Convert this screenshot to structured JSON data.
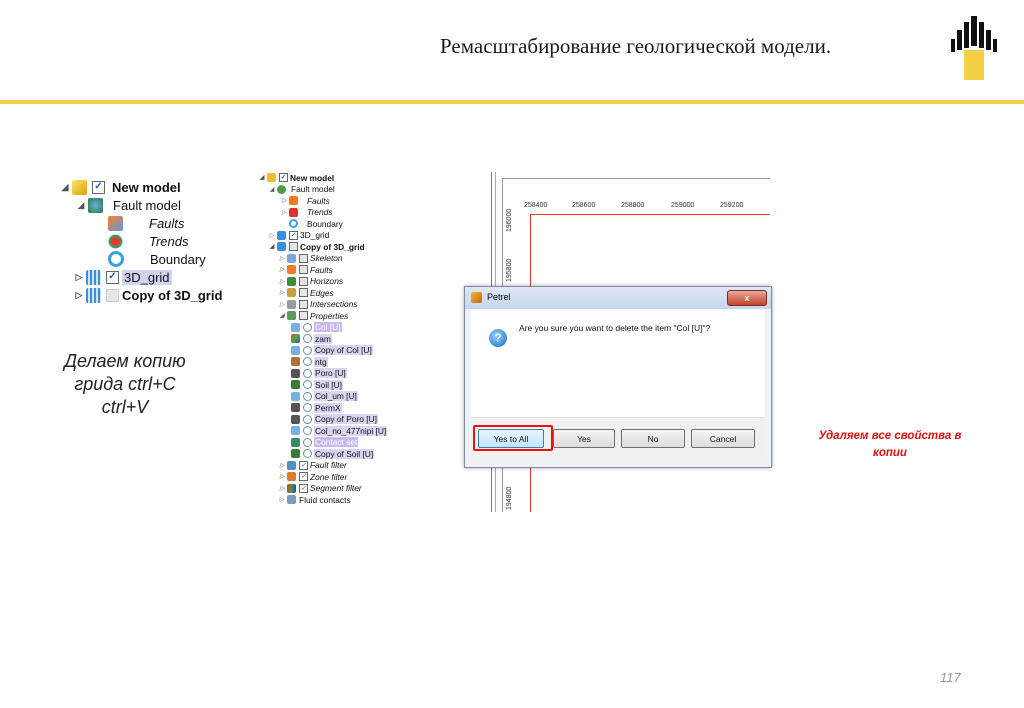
{
  "slide": {
    "title": "Ремасштабирование геологической модели.",
    "page_number": "117",
    "note_left": "Делаем копию грида ctrl+C ctrl+V",
    "note_right": "Удаляем все свойства в копии",
    "accent_color": "#f3cf45",
    "logo_icon": "rosneft-logo-icon"
  },
  "tree_large": {
    "items": [
      {
        "label": "New model"
      },
      {
        "label": "Fault model"
      },
      {
        "label": "Faults"
      },
      {
        "label": "Trends"
      },
      {
        "label": "Boundary"
      },
      {
        "label": "3D_grid"
      },
      {
        "label": "Copy of 3D_grid"
      }
    ]
  },
  "tree_small": {
    "items": [
      {
        "label": "New model"
      },
      {
        "label": "Fault model"
      },
      {
        "label": "Faults"
      },
      {
        "label": "Trends"
      },
      {
        "label": "Boundary"
      },
      {
        "label": "3D_grid"
      },
      {
        "label": "Copy of 3D_grid"
      },
      {
        "label": "Skeleton"
      },
      {
        "label": "Faults"
      },
      {
        "label": "Horizons"
      },
      {
        "label": "Edges"
      },
      {
        "label": "Intersections"
      },
      {
        "label": "Properties"
      },
      {
        "label": "Col [U]"
      },
      {
        "label": "zam"
      },
      {
        "label": "Copy of Col [U]"
      },
      {
        "label": "ntg"
      },
      {
        "label": "Poro [U]"
      },
      {
        "label": "Soil [U]"
      },
      {
        "label": "Col_um [U]"
      },
      {
        "label": "PermX"
      },
      {
        "label": "Copy of Poro [U]"
      },
      {
        "label": "Col_no_477nipi [U]"
      },
      {
        "label": "Contact set"
      },
      {
        "label": "Copy of Soil [U]"
      },
      {
        "label": "Fault filter"
      },
      {
        "label": "Zone filter"
      },
      {
        "label": "Segment filter"
      },
      {
        "label": "Fluid contacts"
      }
    ]
  },
  "map": {
    "x_ticks": [
      "258400",
      "258600",
      "258800",
      "259000",
      "259200"
    ],
    "y_ticks": [
      "196000",
      "195800",
      "194800"
    ]
  },
  "dialog": {
    "title": "Petrel",
    "close_label": "x",
    "message": "Are you sure you want to delete the item \"Col [U]\"?",
    "buttons": {
      "yes_to_all": "Yes to All",
      "yes": "Yes",
      "no": "No",
      "cancel": "Cancel"
    },
    "icon": "question-icon"
  }
}
